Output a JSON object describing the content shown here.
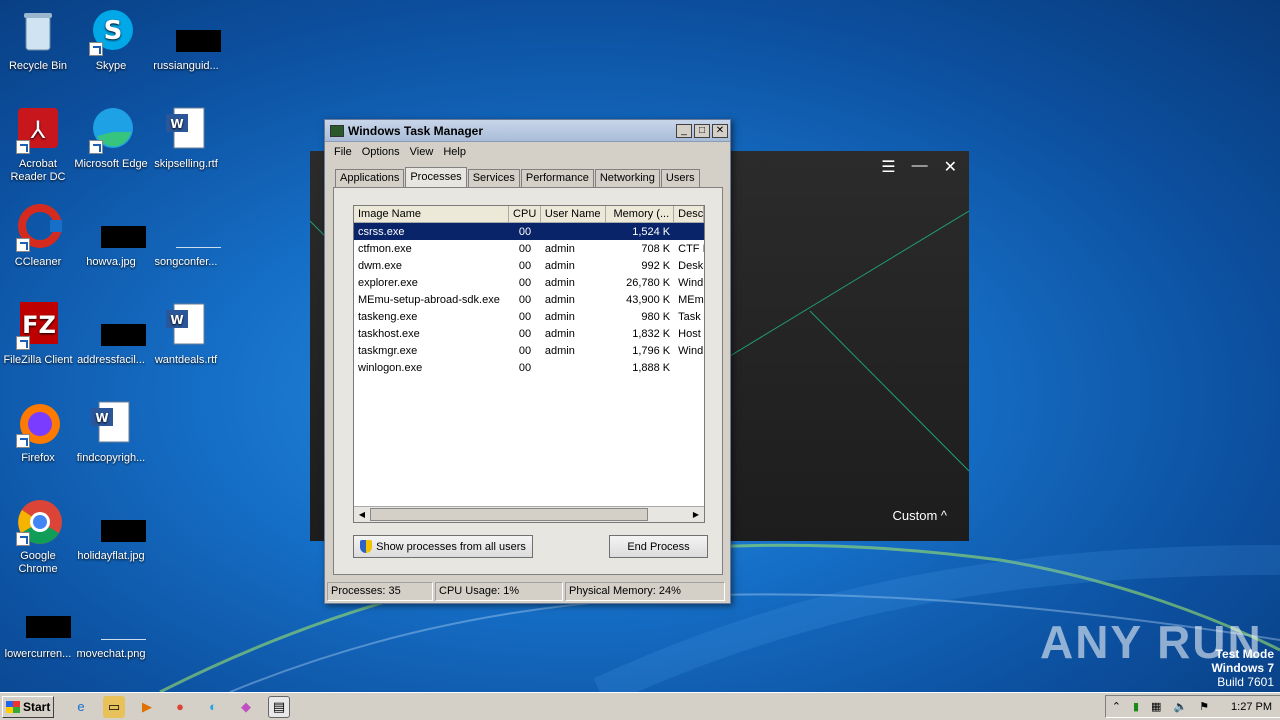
{
  "desktop": {
    "icons": [
      {
        "label": "Recycle Bin",
        "icon": "recycle-bin-icon"
      },
      {
        "label": "Skype",
        "icon": "skype-icon"
      },
      {
        "label": "russianguid...",
        "icon": "image-file-icon"
      },
      {
        "label": "Acrobat Reader DC",
        "icon": "acrobat-icon"
      },
      {
        "label": "Microsoft Edge",
        "icon": "edge-icon"
      },
      {
        "label": "skipselling.rtf",
        "icon": "word-doc-icon"
      },
      {
        "label": "CCleaner",
        "icon": "ccleaner-icon"
      },
      {
        "label": "howva.jpg",
        "icon": "image-file-icon"
      },
      {
        "label": "songconfer...",
        "icon": "image-file-icon"
      },
      {
        "label": "FileZilla Client",
        "icon": "filezilla-icon"
      },
      {
        "label": "addressfacil...",
        "icon": "image-file-icon"
      },
      {
        "label": "wantdeals.rtf",
        "icon": "word-doc-icon"
      },
      {
        "label": "Firefox",
        "icon": "firefox-icon"
      },
      {
        "label": "findcopyrigh...",
        "icon": "word-doc-icon"
      },
      {
        "label": "Google Chrome",
        "icon": "chrome-icon"
      },
      {
        "label": "holidayflat.jpg",
        "icon": "image-file-icon"
      },
      {
        "label": "lowercurren...",
        "icon": "image-file-icon"
      },
      {
        "label": "movechat.png",
        "icon": "image-file-icon"
      }
    ]
  },
  "dark_app": {
    "custom_label": "Custom"
  },
  "task_manager": {
    "title": "Windows Task Manager",
    "menu": [
      "File",
      "Options",
      "View",
      "Help"
    ],
    "tabs": [
      "Applications",
      "Processes",
      "Services",
      "Performance",
      "Networking",
      "Users"
    ],
    "active_tab": "Processes",
    "columns": [
      "Image Name",
      "CPU",
      "User Name",
      "Memory (...",
      "Desc"
    ],
    "rows": [
      {
        "name": "csrss.exe",
        "cpu": "00",
        "user": "",
        "mem": "1,524 K",
        "desc": ""
      },
      {
        "name": "ctfmon.exe",
        "cpu": "00",
        "user": "admin",
        "mem": "708 K",
        "desc": "CTF I"
      },
      {
        "name": "dwm.exe",
        "cpu": "00",
        "user": "admin",
        "mem": "992 K",
        "desc": "Desk"
      },
      {
        "name": "explorer.exe",
        "cpu": "00",
        "user": "admin",
        "mem": "26,780 K",
        "desc": "Wind"
      },
      {
        "name": "MEmu-setup-abroad-sdk.exe",
        "cpu": "00",
        "user": "admin",
        "mem": "43,900 K",
        "desc": "MEm"
      },
      {
        "name": "taskeng.exe",
        "cpu": "00",
        "user": "admin",
        "mem": "980 K",
        "desc": "Task"
      },
      {
        "name": "taskhost.exe",
        "cpu": "00",
        "user": "admin",
        "mem": "1,832 K",
        "desc": "Host"
      },
      {
        "name": "taskmgr.exe",
        "cpu": "00",
        "user": "admin",
        "mem": "1,796 K",
        "desc": "Wind"
      },
      {
        "name": "winlogon.exe",
        "cpu": "00",
        "user": "",
        "mem": "1,888 K",
        "desc": ""
      }
    ],
    "show_all_label": "Show processes from all users",
    "end_process_label": "End Process",
    "status": {
      "processes": "Processes: 35",
      "cpu": "CPU Usage: 1%",
      "memory": "Physical Memory: 24%"
    }
  },
  "taskbar": {
    "start_label": "Start",
    "clock": "1:27 PM"
  },
  "watermark": {
    "line1": "Test Mode",
    "line2": "Windows 7",
    "line3": "Build 7601",
    "brand": "ANY RUN"
  }
}
